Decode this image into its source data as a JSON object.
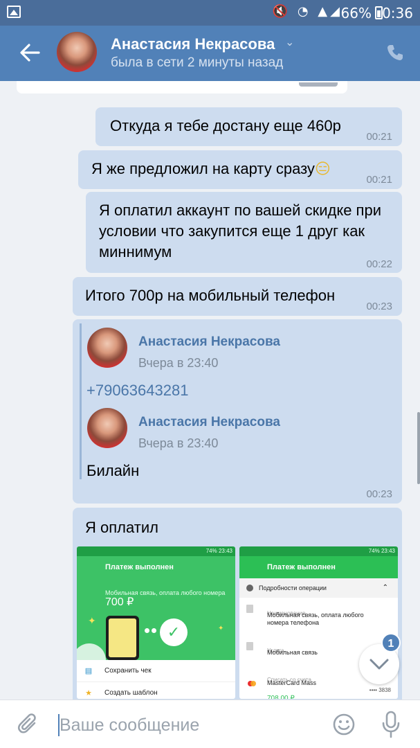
{
  "status_bar": {
    "battery": "66%",
    "time": "0:36",
    "icons": [
      "gallery-icon",
      "mute-icon",
      "wifi-icon",
      "signal-icon"
    ]
  },
  "header": {
    "name": "Анастасия Некрасова",
    "status": "была в сети 2 минуты назад",
    "color": "#5181b8"
  },
  "messages": [
    {
      "text": "Откуда я тебе достану еще 460р",
      "time": "00:21"
    },
    {
      "text": "Я же предложил на карту сразу",
      "emoji": "😑",
      "time": "00:21"
    },
    {
      "text": "Я оплатил аккаунт по вашей скидке при условии что закупится еще 1 друг как миннимум",
      "time": "00:22"
    },
    {
      "text": "Итого 700р на мобильный телефон",
      "time": "00:23"
    }
  ],
  "forwarded": {
    "time": "00:23",
    "items": [
      {
        "author": "Анастасия Некрасова",
        "date": "Вчера в 23:40",
        "text": "+79063643281"
      },
      {
        "author": "Анастасия Некрасова",
        "date": "Вчера в 23:40",
        "text": "Билайн"
      }
    ]
  },
  "photo_message": {
    "text": "Я оплатил",
    "screenshot_left": {
      "status": "74% 23:43",
      "title": "Платеж выполнен",
      "subtitle": "Мобильная связь, оплата любого номера",
      "amount": "700 ₽",
      "actions": [
        "Сохранить чек",
        "Создать шаблон"
      ]
    },
    "screenshot_right": {
      "status": "74% 23:43",
      "title": "Платеж выполнен",
      "section": "Подробности операции",
      "name_label": "Наименование",
      "name_value": "Мобильная связь, оплата любого номера телефона",
      "service_label": "Услуга",
      "service_value": "Мобильная связь",
      "account_label": "Списать со счета",
      "account_value": "MasterCard Mass",
      "card_mask": "•••• 3838",
      "price": "708,00 ₽"
    }
  },
  "scroll_button": {
    "badge": "1"
  },
  "input": {
    "placeholder": "Ваше сообщение"
  }
}
